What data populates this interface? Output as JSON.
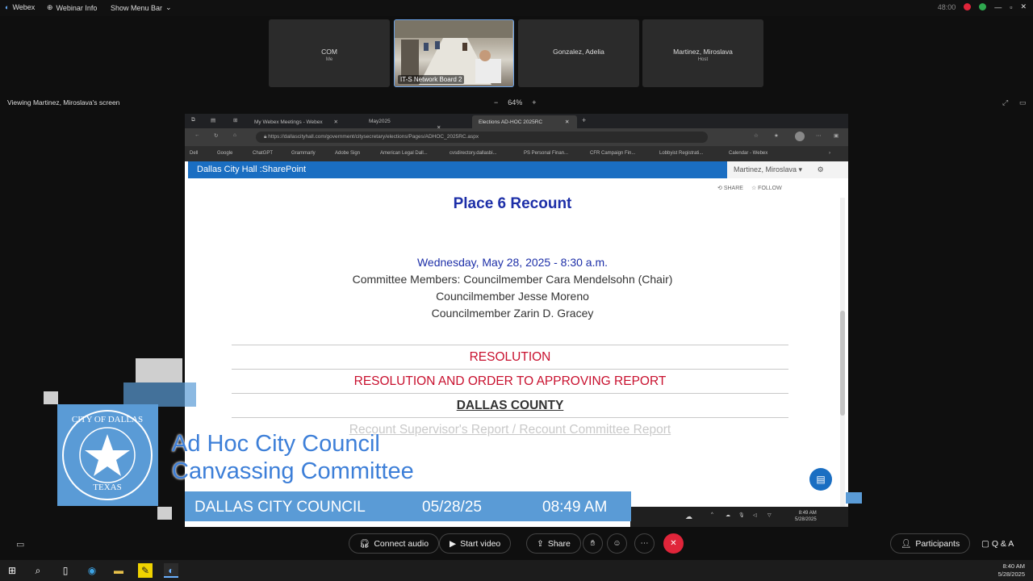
{
  "topbar": {
    "app_name": "Webex",
    "webinar_info": "Webinar Info",
    "show_menu_bar": "Show Menu Bar",
    "right_text": "48:00"
  },
  "participants": [
    {
      "name": "COM",
      "sub": "Me"
    },
    {
      "name": "IT-S Network Board 2",
      "sub": ""
    },
    {
      "name": "Gonzalez, Adelia",
      "sub": ""
    },
    {
      "name": "Martinez, Miroslava",
      "sub": "Host"
    }
  ],
  "viewing_text": "Viewing Martinez, Miroslava's screen",
  "zoom": {
    "minus": "−",
    "level": "64%",
    "plus": "+"
  },
  "browser": {
    "tabs": [
      "My Webex Meetings - Webex",
      "May2025",
      "Elections AD-HOC 2025RC"
    ],
    "new_tab": "+",
    "url": "https://dallascityhall.com/government/citysecretary/elections/Pages/ADHOC_2025RC.aspx",
    "bookmarks": [
      "Dell",
      "Google",
      "ChatGPT",
      "Grammarly",
      "Adobe Sign",
      "American Legal Dall...",
      "cvsdirectory.dallasbi...",
      "PS Personal Finan...",
      "CFR Campaign Fin...",
      "Lobbyist Registrati...",
      "Calendar - Webex"
    ]
  },
  "sharepoint": {
    "site_title": "Dallas City Hall :SharePoint",
    "user": "Martinez, Miroslava ▾",
    "share": "SHARE",
    "follow": "FOLLOW"
  },
  "page": {
    "title": "Place 6 Recount",
    "date_line": "Wednesday, May 28, 2025 - 8:30 a.m.",
    "members": [
      "Committee Members: Councilmember Cara Mendelsohn (Chair)",
      "Councilmember Jesse Moreno",
      "Councilmember Zarin D. Gracey"
    ],
    "agenda": [
      "RESOLUTION",
      "RESOLUTION AND ORDER TO APPROVING REPORT",
      "DALLAS COUNTY",
      "Recount Supervisor's Report / Recount Committee Report"
    ]
  },
  "inner_taskbar": {
    "time": "8:49 AM",
    "date": "5/28/2025"
  },
  "overlay": {
    "seal_top": "CITY OF DALLAS",
    "seal_bottom": "TEXAS",
    "title_line1": "Ad Hoc City Council",
    "title_line2": "Canvassing Committee",
    "ticker_org": "DALLAS CITY COUNCIL",
    "ticker_date": "05/28/25",
    "ticker_time": "08:49 AM"
  },
  "controls": {
    "connect_audio": "Connect audio",
    "start_video": "Start video",
    "share": "Share",
    "participants": "Participants",
    "qa": "Q & A"
  },
  "windows_clock": {
    "time": "8:40 AM",
    "date": "5/28/2025"
  },
  "colors": {
    "accent": "#1a6ec2",
    "overlay_blue": "#5a9bd6",
    "title_blue": "#1d2fa8",
    "alert_red": "#c8102e",
    "end_red": "#e0253a"
  }
}
